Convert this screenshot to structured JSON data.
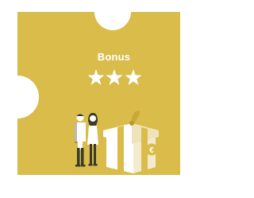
{
  "card": {
    "title": "Bonus",
    "rating": {
      "value": 3,
      "max": 3
    }
  },
  "colors": {
    "background": "#d9bc4a",
    "foreground": "#ffffff",
    "figure_dark": "#3a3a2a"
  },
  "icons": {
    "stars": "star-icon",
    "people": "couple-illustration",
    "gift": "gift-box-illustration",
    "currency": "euro-icon"
  }
}
